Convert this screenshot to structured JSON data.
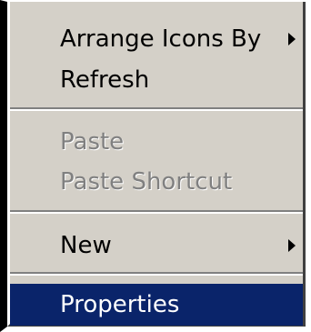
{
  "context_menu": {
    "items": [
      {
        "label": "Arrange Icons By",
        "has_submenu": true,
        "disabled": false
      },
      {
        "label": "Refresh",
        "has_submenu": false,
        "disabled": false
      },
      {
        "label": "Paste",
        "has_submenu": false,
        "disabled": true
      },
      {
        "label": "Paste Shortcut",
        "has_submenu": false,
        "disabled": true
      },
      {
        "label": "New",
        "has_submenu": true,
        "disabled": false
      },
      {
        "label": "Properties",
        "has_submenu": false,
        "disabled": false,
        "highlighted": true
      }
    ],
    "icons": {
      "submenu_arrow": "chevron-right-icon"
    },
    "colors": {
      "menu_background": "#d4d0c8",
      "highlight_background": "#0a246a",
      "highlight_text": "#ffffff",
      "disabled_text": "#808080",
      "separator_dark": "#808080",
      "separator_light": "#ffffff"
    }
  }
}
